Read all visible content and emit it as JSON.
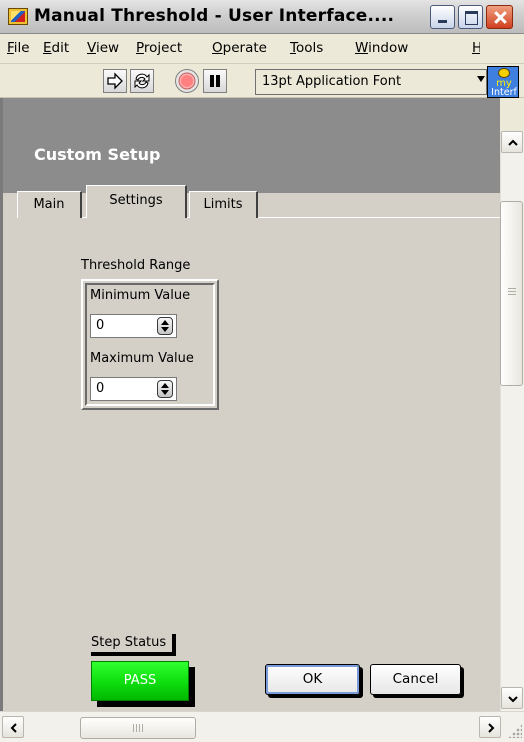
{
  "window": {
    "title": "Manual Threshold - User Interface....",
    "app_icon": "labview-vi-icon"
  },
  "menu": [
    {
      "label": "File",
      "mnemonic": "F",
      "rest": "ile"
    },
    {
      "label": "Edit",
      "mnemonic": "E",
      "rest": "dit"
    },
    {
      "label": "View",
      "mnemonic": "V",
      "rest": "iew"
    },
    {
      "label": "Project",
      "mnemonic": "P",
      "rest": "roject"
    },
    {
      "label": "Operate",
      "mnemonic": "O",
      "rest": "perate"
    },
    {
      "label": "Tools",
      "mnemonic": "T",
      "rest": "ools"
    },
    {
      "label": "Window",
      "mnemonic": "W",
      "rest": "indow"
    },
    {
      "label": "H",
      "mnemonic": "H",
      "rest": ""
    }
  ],
  "toolbar": {
    "font_select": "13pt Application Font",
    "icons": [
      "run-arrow-icon",
      "run-continuously-icon",
      "abort-icon",
      "pause-icon"
    ]
  },
  "vi_icon": {
    "line1": "my",
    "line2": "Interf"
  },
  "header": {
    "title": "Custom Setup"
  },
  "tabs": [
    {
      "label": "Main",
      "active": false
    },
    {
      "label": "Settings",
      "active": true
    },
    {
      "label": "Limits",
      "active": false
    }
  ],
  "threshold": {
    "group_label": "Threshold Range",
    "min_label": "Minimum Value",
    "min_value": "0",
    "max_label": "Maximum Value",
    "max_value": "0"
  },
  "status": {
    "label": "Step Status",
    "value": "PASS",
    "color": "#22ee22"
  },
  "buttons": {
    "ok": "OK",
    "cancel": "Cancel"
  },
  "colors": {
    "header_bg": "#8c8c8c",
    "panel_bg": "#d4d0c8",
    "close_button": "#d04020"
  }
}
